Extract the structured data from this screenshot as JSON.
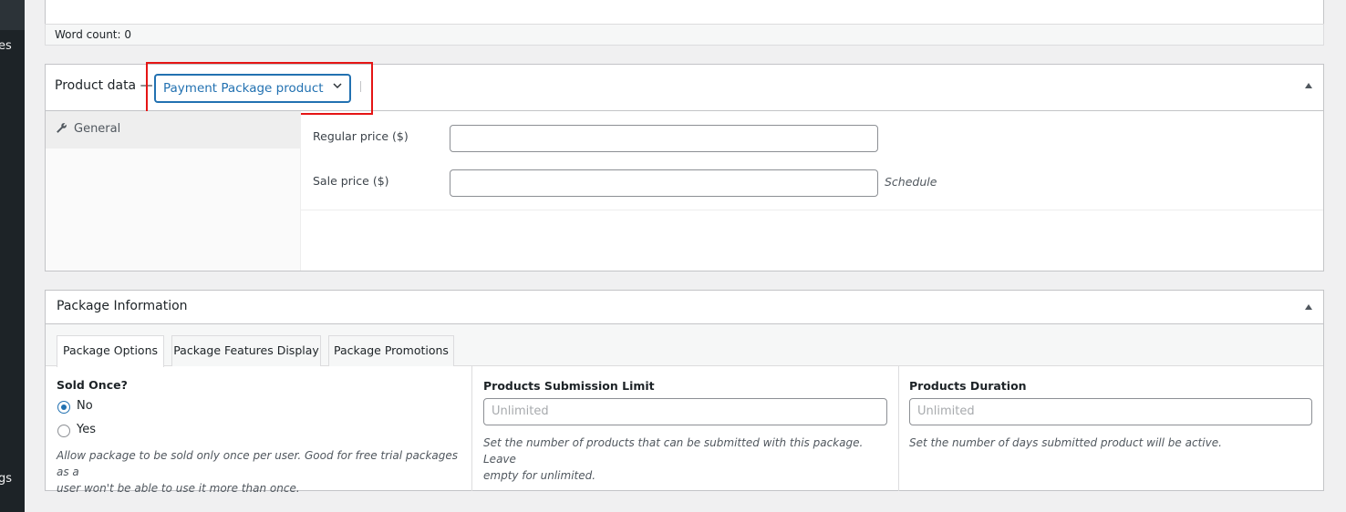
{
  "sidebar": {
    "fragment_top": "es",
    "fragment_bottom": "gs"
  },
  "editor": {
    "word_count": "Word count: 0"
  },
  "product_data": {
    "title": "Product data —",
    "type_select": "Payment Package product",
    "tabs": [
      {
        "label": "General",
        "icon": "wrench-icon"
      }
    ],
    "regular_price_label": "Regular price ($)",
    "sale_price_label": "Sale price ($)",
    "schedule_link": "Schedule",
    "colors": {
      "highlight": "#e51515",
      "accent": "#2271b1"
    }
  },
  "package_info": {
    "title": "Package Information",
    "tabs": [
      "Package Options",
      "Package Features Display",
      "Package Promotions"
    ],
    "sold_once": {
      "title": "Sold Once?",
      "options": [
        "No",
        "Yes"
      ],
      "selected": "No",
      "description": "Allow package to be sold only once per user. Good for free trial packages as a user won't be able to use it more than once.",
      "description_line1": "Allow package to be sold only once per user. Good for free trial packages as a",
      "description_line2": "user won't be able to use it more than once."
    },
    "submission_limit": {
      "title": "Products Submission Limit",
      "placeholder": "Unlimited",
      "description_line1": "Set the number of products that can be submitted with this package. Leave",
      "description_line2": "empty for unlimited."
    },
    "duration": {
      "title": "Products Duration",
      "placeholder": "Unlimited",
      "description": "Set the number of days submitted product will be active."
    }
  }
}
